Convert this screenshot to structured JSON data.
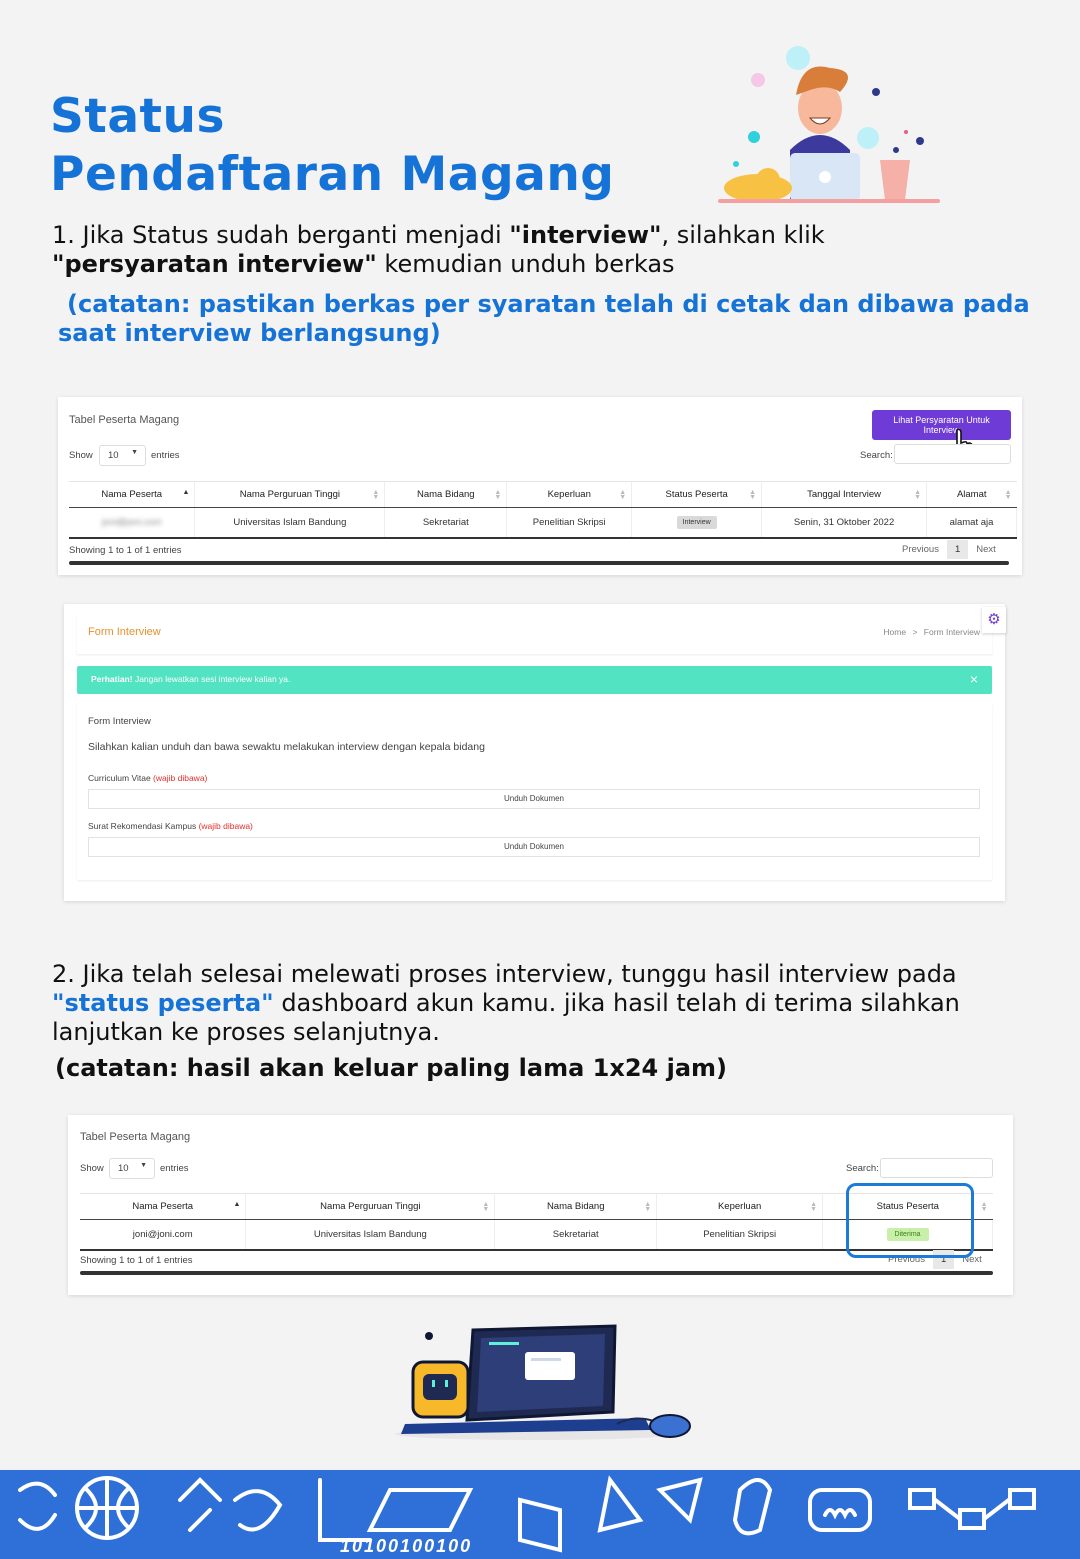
{
  "header": {
    "title_line1": "Status",
    "title_line2": "Pendaftaran Magang"
  },
  "step1": {
    "p1": "1. Jika Status sudah berganti menjadi ",
    "k1": "\"interview\"",
    "p2": ", silahkan klik",
    "k2": "\"persyaratan interview\"",
    "p3": " kemudian unduh berkas",
    "note_line1": "(catatan: pastikan berkas per syaratan telah di cetak dan dibawa pada",
    "note_line2": "saat interview berlangsung)"
  },
  "table1": {
    "title": "Tabel Peserta Magang",
    "button": "Lihat Persyaratan Untuk Interview",
    "show": "Show",
    "entries_value": "10",
    "entries": "entries",
    "search": "Search:",
    "headers": [
      "Nama Peserta",
      "Nama Perguruan Tinggi",
      "Nama Bidang",
      "Keperluan",
      "Status Peserta",
      "Tanggal Interview",
      "Alamat"
    ],
    "row": [
      "joni@joni.com",
      "Universitas Islam Bandung",
      "Sekretariat",
      "Penelitian Skripsi",
      "Interview",
      "Senin, 31 Oktober 2022",
      "alamat aja"
    ],
    "info": "Showing 1 to 1 of 1 entries",
    "prev": "Previous",
    "page": "1",
    "next": "Next"
  },
  "form": {
    "title": "Form Interview",
    "crumb_home": "Home",
    "crumb_sep": ">",
    "crumb_current": "Form Interview",
    "alert_bold": "Perhatian!",
    "alert_text": " Jangan lewatkan sesi interview kalian ya.",
    "alert_close": "×",
    "card_title": "Form Interview",
    "desc": "Silahkan kalian unduh dan bawa sewaktu melakukan interview dengan kepala bidang",
    "cv_label": "Curriculum Vitae ",
    "cv_req": "(wajib dibawa)",
    "cv_btn": "Unduh Dokumen",
    "rec_label": "Surat Rekomendasi Kampus ",
    "rec_req": "(wajib dibawa)",
    "rec_btn": "Unduh Dokumen",
    "gear_icon": "⚙"
  },
  "step2": {
    "line1": "2. Jika telah selesai melewati proses interview, tunggu hasil interview pada",
    "k1": "\"status peserta\"",
    "line2b": " dashboard akun kamu. jika hasil telah di terima silahkan",
    "line3": "lanjutkan ke proses selanjutnya.",
    "note": "(catatan:  hasil akan keluar paling lama 1x24 jam)"
  },
  "table2": {
    "title": "Tabel Peserta Magang",
    "show": "Show",
    "entries_value": "10",
    "entries": "entries",
    "search": "Search:",
    "headers": [
      "Nama Peserta",
      "Nama Perguruan Tinggi",
      "Nama Bidang",
      "Keperluan",
      "Status Peserta"
    ],
    "row": [
      "joni@joni.com",
      "Universitas Islam Bandung",
      "Sekretariat",
      "Penelitian Skripsi",
      "Diterima"
    ],
    "info": "Showing 1 to 1 of 1 entries",
    "prev": "Previous",
    "page": "1",
    "next": "Next"
  },
  "footer": {
    "code": "10100100100"
  },
  "colors": {
    "brand_blue": "#1572d6",
    "purple": "#6f3bd6",
    "alert_teal": "#52e3c2",
    "footer_blue": "#2f6fd8"
  }
}
